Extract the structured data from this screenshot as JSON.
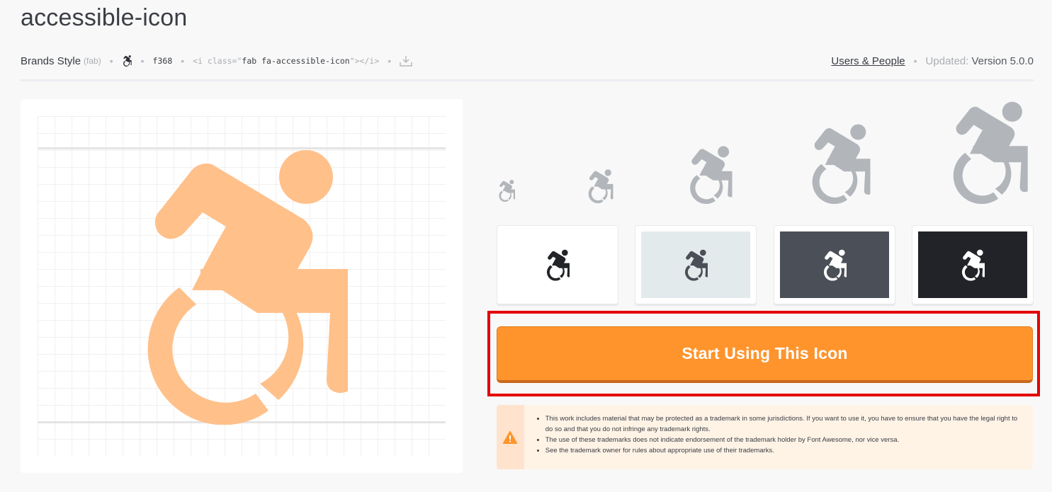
{
  "page": {
    "title": "accessible-icon"
  },
  "meta": {
    "style_label": "Brands Style",
    "style_prefix": "(fab)",
    "unicode": "f368",
    "code_open": "<i class=\"",
    "code_class": "fab fa-accessible-icon",
    "code_close": "\"></i>",
    "category_link": "Users & People",
    "updated_label": "Updated:",
    "updated_value": "Version 5.0.0",
    "icons": {
      "glyph": "accessible-icon",
      "download": "download-icon",
      "separator": "•"
    }
  },
  "preview": {
    "icon": "accessible-icon",
    "icon_color": "#ffc08a",
    "grid_color": "#f0f0f0"
  },
  "size_previews": {
    "icon": "accessible-icon",
    "color": "#b2b6bb",
    "count": 5
  },
  "swatches": [
    {
      "name": "white",
      "background": "#ffffff",
      "icon_color": "#222428"
    },
    {
      "name": "light-gray",
      "background": "#e3eaec",
      "icon_color": "#4a4f57"
    },
    {
      "name": "dark-gray",
      "background": "#4b5058",
      "icon_color": "#ffffff"
    },
    {
      "name": "black",
      "background": "#212328",
      "icon_color": "#ffffff"
    }
  ],
  "cta": {
    "label": "Start Using This Icon",
    "color": "#ff942c"
  },
  "notice": {
    "icon": "warning-icon",
    "icon_color": "#ff942c",
    "items": [
      "This work includes material that may be protected as a trademark in some jurisdictions. If you want to use it, you have to ensure that you have the legal right to do so and that you do not infringe any trademark rights.",
      "The use of these trademarks does not indicate endorsement of the trademark holder by Font Awesome, nor vice versa.",
      "See the trademark owner for rules about appropriate use of their trademarks."
    ]
  }
}
